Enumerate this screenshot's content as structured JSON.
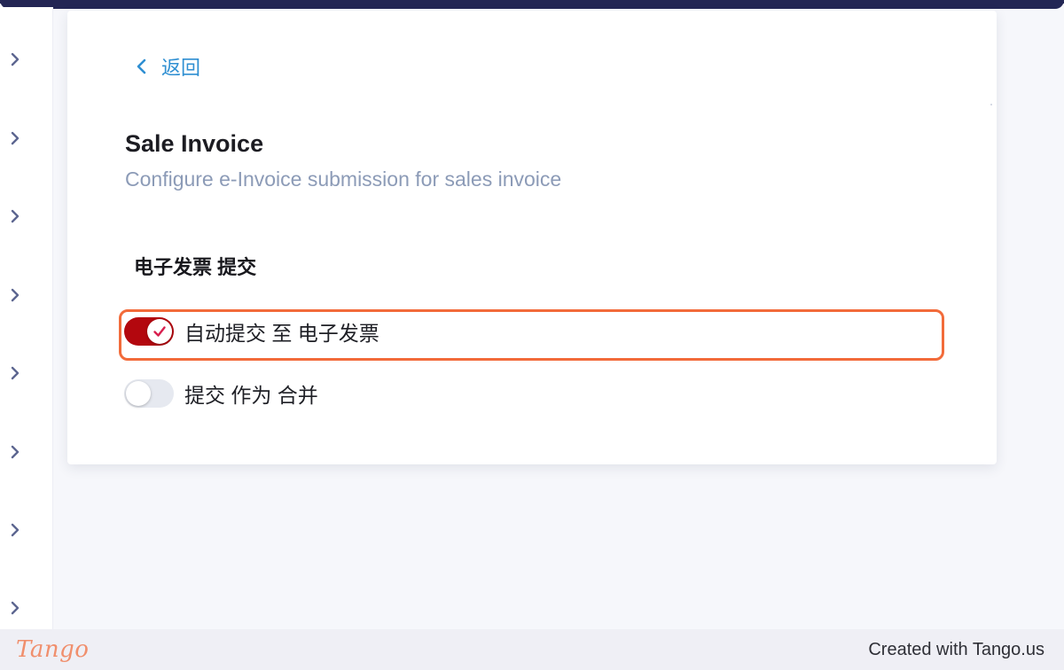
{
  "window": {
    "border_color": "#232654",
    "background": "#f6f7fb"
  },
  "sidebar": {
    "items": [
      {
        "icon": "chevron-right-icon"
      },
      {
        "icon": "chevron-right-icon"
      },
      {
        "icon": "chevron-right-icon"
      },
      {
        "icon": "chevron-right-icon"
      },
      {
        "icon": "chevron-right-icon"
      },
      {
        "icon": "chevron-right-icon"
      },
      {
        "icon": "chevron-right-icon"
      },
      {
        "icon": "chevron-right-icon"
      }
    ]
  },
  "card": {
    "back_label": "返回",
    "back_icon": "chevron-left-icon",
    "title": "Sale Invoice",
    "subtitle": "Configure e-Invoice submission for sales invoice",
    "section_heading": "电子发票 提交",
    "toggles": [
      {
        "label": "自动提交 至 电子发票",
        "enabled": true,
        "color_on": "#b3070e",
        "icon": "check-icon"
      },
      {
        "label": "提交 作为 合并",
        "enabled": false,
        "color_off": "#e6e9f0"
      }
    ]
  },
  "highlight": {
    "color": "#f26b3a"
  },
  "footer": {
    "logo_text": "Tango",
    "credit": "Created with Tango.us"
  }
}
